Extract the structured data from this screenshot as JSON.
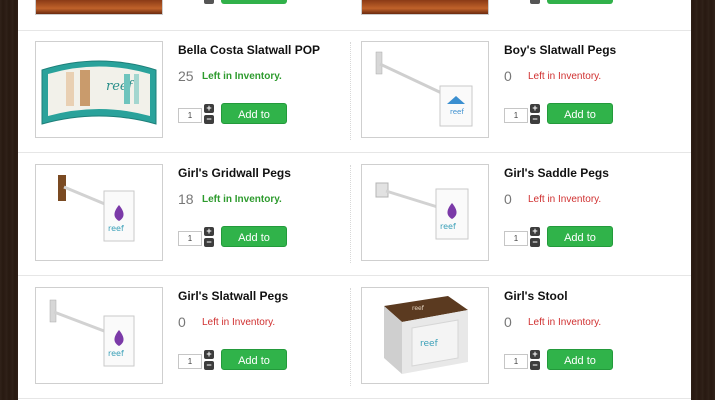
{
  "products": [
    {
      "name": "Bella Costa Slatwall POP",
      "qty": "25",
      "inventory_label": "Left in Inventory.",
      "status": "ok",
      "input": "1",
      "cart_label": "Add to Cart",
      "image": "slatwall-pop-display"
    },
    {
      "name": "Boy's Slatwall Pegs",
      "qty": "0",
      "inventory_label": "Left in Inventory.",
      "status": "none",
      "input": "1",
      "cart_label": "Add to Cart",
      "image": "slatwall-peg-blue-logo"
    },
    {
      "name": "Girl's Gridwall Pegs",
      "qty": "18",
      "inventory_label": "Left in Inventory.",
      "status": "ok",
      "input": "1",
      "cart_label": "Add to Cart",
      "image": "gridwall-peg-purple-logo"
    },
    {
      "name": "Girl's Saddle Pegs",
      "qty": "0",
      "inventory_label": "Left in Inventory.",
      "status": "none",
      "input": "1",
      "cart_label": "Add to Cart",
      "image": "saddle-peg-purple-logo"
    },
    {
      "name": "Girl's Slatwall Pegs",
      "qty": "0",
      "inventory_label": "Left in Inventory.",
      "status": "none",
      "input": "1",
      "cart_label": "Add to Cart",
      "image": "slatwall-peg-purple-logo"
    },
    {
      "name": "Girl's Stool",
      "qty": "0",
      "inventory_label": "Left in Inventory.",
      "status": "none",
      "input": "1",
      "cart_label": "Add to Cart",
      "image": "stool"
    }
  ],
  "stepper": {
    "plus": "+",
    "minus": "−"
  },
  "colors": {
    "cart_green": "#30b34a",
    "in_stock_green": "#2e9b2e",
    "out_of_stock_red": "#d03030"
  }
}
